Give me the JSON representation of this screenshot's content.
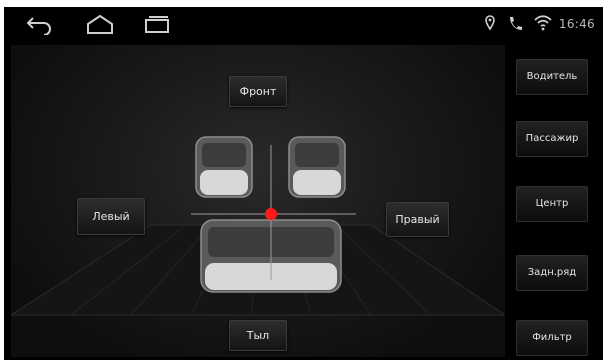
{
  "status_bar": {
    "time": "16:46",
    "nav_icons": [
      "back-icon",
      "home-icon",
      "recent-apps-icon"
    ],
    "status_icons": [
      "location-icon",
      "phone-icon",
      "wifi-icon"
    ]
  },
  "balance": {
    "front_label": "Фронт",
    "rear_label": "Тыл",
    "left_label": "Левый",
    "right_label": "Правый",
    "focus_point_color": "#ff1a1a"
  },
  "side_menu": [
    {
      "label": "Водитель"
    },
    {
      "label": "Пассажир"
    },
    {
      "label": "Центр"
    },
    {
      "label": "Задн.ряд"
    },
    {
      "label": "Фильтр"
    }
  ]
}
